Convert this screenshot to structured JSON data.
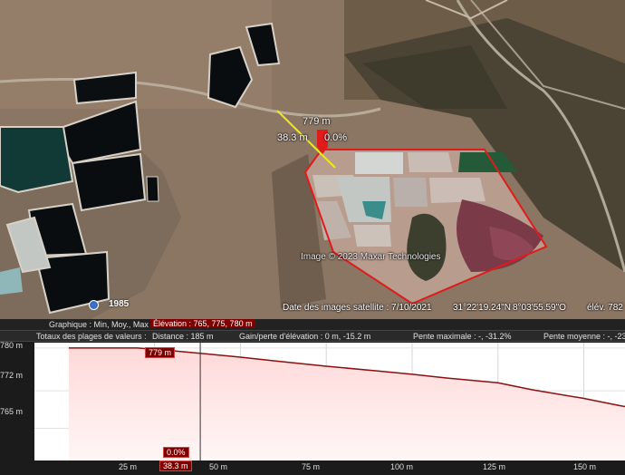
{
  "map": {
    "cursor": {
      "distance_label": "779 m",
      "left_label": "38.3 m",
      "right_label": "0.0%"
    },
    "copyright": "Image © 2023 Maxar Technologies",
    "history_year": "1985",
    "status": {
      "date": "Date des images satellite : 7/10/2021",
      "lat": "31°22'19.24\"N",
      "lon": "8°03'55.59\"O",
      "elev_label": "élév.  782"
    }
  },
  "profile": {
    "header": {
      "graph_label": "Graphique : Min, Moy., Max",
      "elevation_summary": "Élévation : 765, 775, 780 m",
      "totals_label": "Totaux des plages de valeurs :",
      "distance": "Distance : 185 m",
      "gain_loss": "Gain/perte d'élévation : 0 m, -15.2 m",
      "max_slope": "Pente maximale : -, -31.2%",
      "avg_slope": "Pente moyenne : -, -23"
    },
    "cursor_tag_elev": "779 m",
    "cursor_tag_slope": "0.0%",
    "cursor_tag_dist": "38.3 m",
    "y_labels": [
      "780 m",
      "772 m",
      "765 m"
    ],
    "x_labels": [
      "25 m",
      "50 m",
      "75 m",
      "100 m",
      "125 m",
      "150 m"
    ]
  },
  "chart_data": {
    "type": "area",
    "x": [
      0,
      10,
      20,
      30,
      38.3,
      50,
      60,
      75,
      90,
      100,
      110,
      125,
      135,
      150,
      160,
      170
    ],
    "y": [
      780,
      780,
      780,
      779.5,
      779,
      778.3,
      777.6,
      776.6,
      775.7,
      775.1,
      774.4,
      773.5,
      772.2,
      770.6,
      769.3,
      768.1
    ],
    "xlabel": "",
    "ylabel": "",
    "xlim": [
      -10,
      162
    ],
    "ylim": [
      759,
      781
    ],
    "cursor_x": 38.3
  }
}
